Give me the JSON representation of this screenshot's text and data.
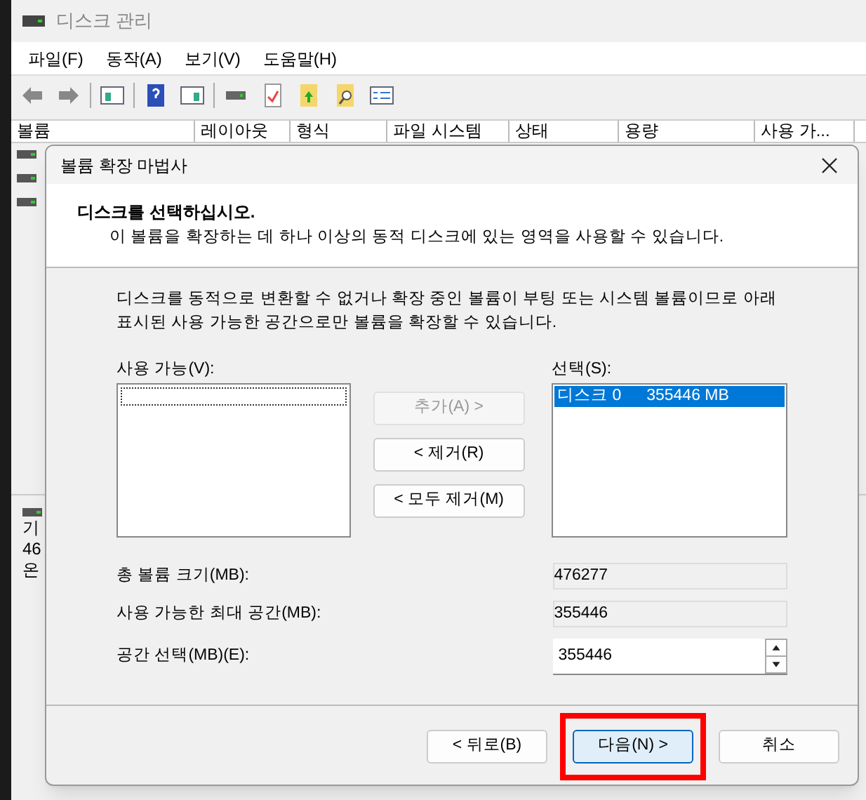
{
  "window": {
    "title": "디스크 관리"
  },
  "menu": [
    "파일(F)",
    "동작(A)",
    "보기(V)",
    "도움말(H)"
  ],
  "table": {
    "columns": [
      "볼륨",
      "레이아웃",
      "형식",
      "파일 시스템",
      "상태",
      "용량",
      "사용 가..."
    ]
  },
  "disk_panel": {
    "lines": [
      "기",
      "46",
      "온"
    ]
  },
  "dialog": {
    "title": "볼륨 확장 마법사",
    "header": {
      "title": "디스크를 선택하십시오.",
      "subtitle": "이 볼륨을 확장하는 데 하나 이상의 동적 디스크에 있는 영역을 사용할 수 있습니다."
    },
    "note": "디스크를 동적으로 변환할 수 없거나 확장 중인 볼륨이 부팅 또는 시스템 볼륨이므로 아래 표시된 사용 가능한 공간으로만 볼륨을 확장할 수 있습니다.",
    "available": {
      "label": "사용 가능(V):"
    },
    "selected": {
      "label": "선택(S):",
      "items": [
        {
          "disk": "디스크 0",
          "size": "355446 MB",
          "selected": true
        }
      ]
    },
    "move_buttons": [
      {
        "label": "추가(A) >",
        "disabled": true
      },
      {
        "label": "< 제거(R)",
        "disabled": false
      },
      {
        "label": "< 모두 제거(M)",
        "disabled": false
      }
    ],
    "fields": [
      {
        "kind": "readonly",
        "label": "총 볼륨 크기(MB):",
        "value": "476277"
      },
      {
        "kind": "readonly",
        "label": "사용 가능한 최대 공간(MB):",
        "value": "355446"
      },
      {
        "kind": "spinner",
        "label": "공간 선택(MB)(E):",
        "value": "355446"
      }
    ],
    "buttons": [
      {
        "label": "< 뒤로(B)",
        "default": false,
        "highlighted": false
      },
      {
        "label": "다음(N) >",
        "default": true,
        "highlighted": true
      },
      {
        "label": "취소",
        "default": false,
        "highlighted": false
      }
    ]
  }
}
